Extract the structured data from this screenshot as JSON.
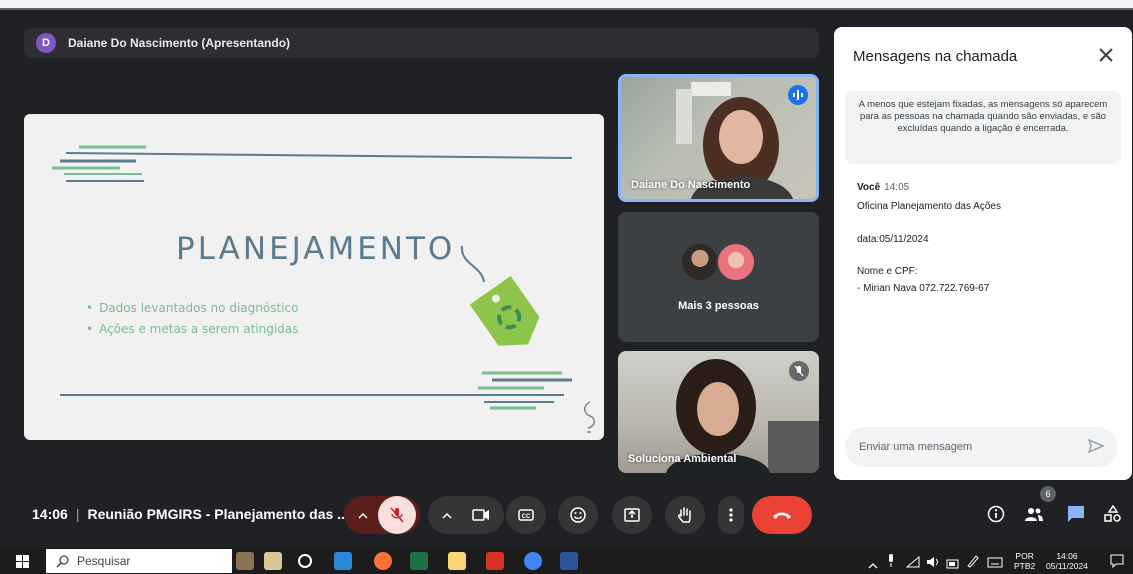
{
  "presenter": {
    "initial": "D",
    "label": "Daiane Do Nascimento (Apresentando)"
  },
  "slide": {
    "title": "PLANEJAMENTO",
    "bullets": [
      "Dados levantados no diagnóstico",
      "Ações e metas a serem atingidas"
    ]
  },
  "tiles": [
    {
      "name": "Daiane Do Nascimento",
      "state": "speaking"
    },
    {
      "name": "Mais 3 pessoas"
    },
    {
      "name": "Soluciona Ambiental",
      "state": "muted"
    }
  ],
  "chat": {
    "title": "Mensagens na chamada",
    "notice": "A menos que estejam fixadas, as mensagens só aparecem para as pessoas na chamada quando são enviadas, e são excluídas quando a ligação é encerrada.",
    "message": {
      "sender": "Você",
      "time": "14:05",
      "lines": [
        "Oficina Planejamento das Ações",
        "data:05/11/2024",
        "Nome e CPF:",
        "- Mirian Nava  072.722.769-67"
      ]
    },
    "input_placeholder": "Enviar uma mensagem"
  },
  "meeting": {
    "time": "14:06",
    "separator": "|",
    "title": "Reunião PMGIRS - Planejamento das ..."
  },
  "participants_count": "6",
  "taskbar": {
    "search_placeholder": "Pesquisar",
    "lang_top": "POR",
    "lang_bottom": "PTB2",
    "clock_time": "14:06",
    "clock_date": "05/11/2024"
  },
  "colors": {
    "accent_blue": "#1a73e8",
    "end_call_red": "#ea4335",
    "mic_muted_bg": "#f9dedc",
    "slide_title": "#5c7b8f",
    "slide_green": "#7bbd93"
  }
}
